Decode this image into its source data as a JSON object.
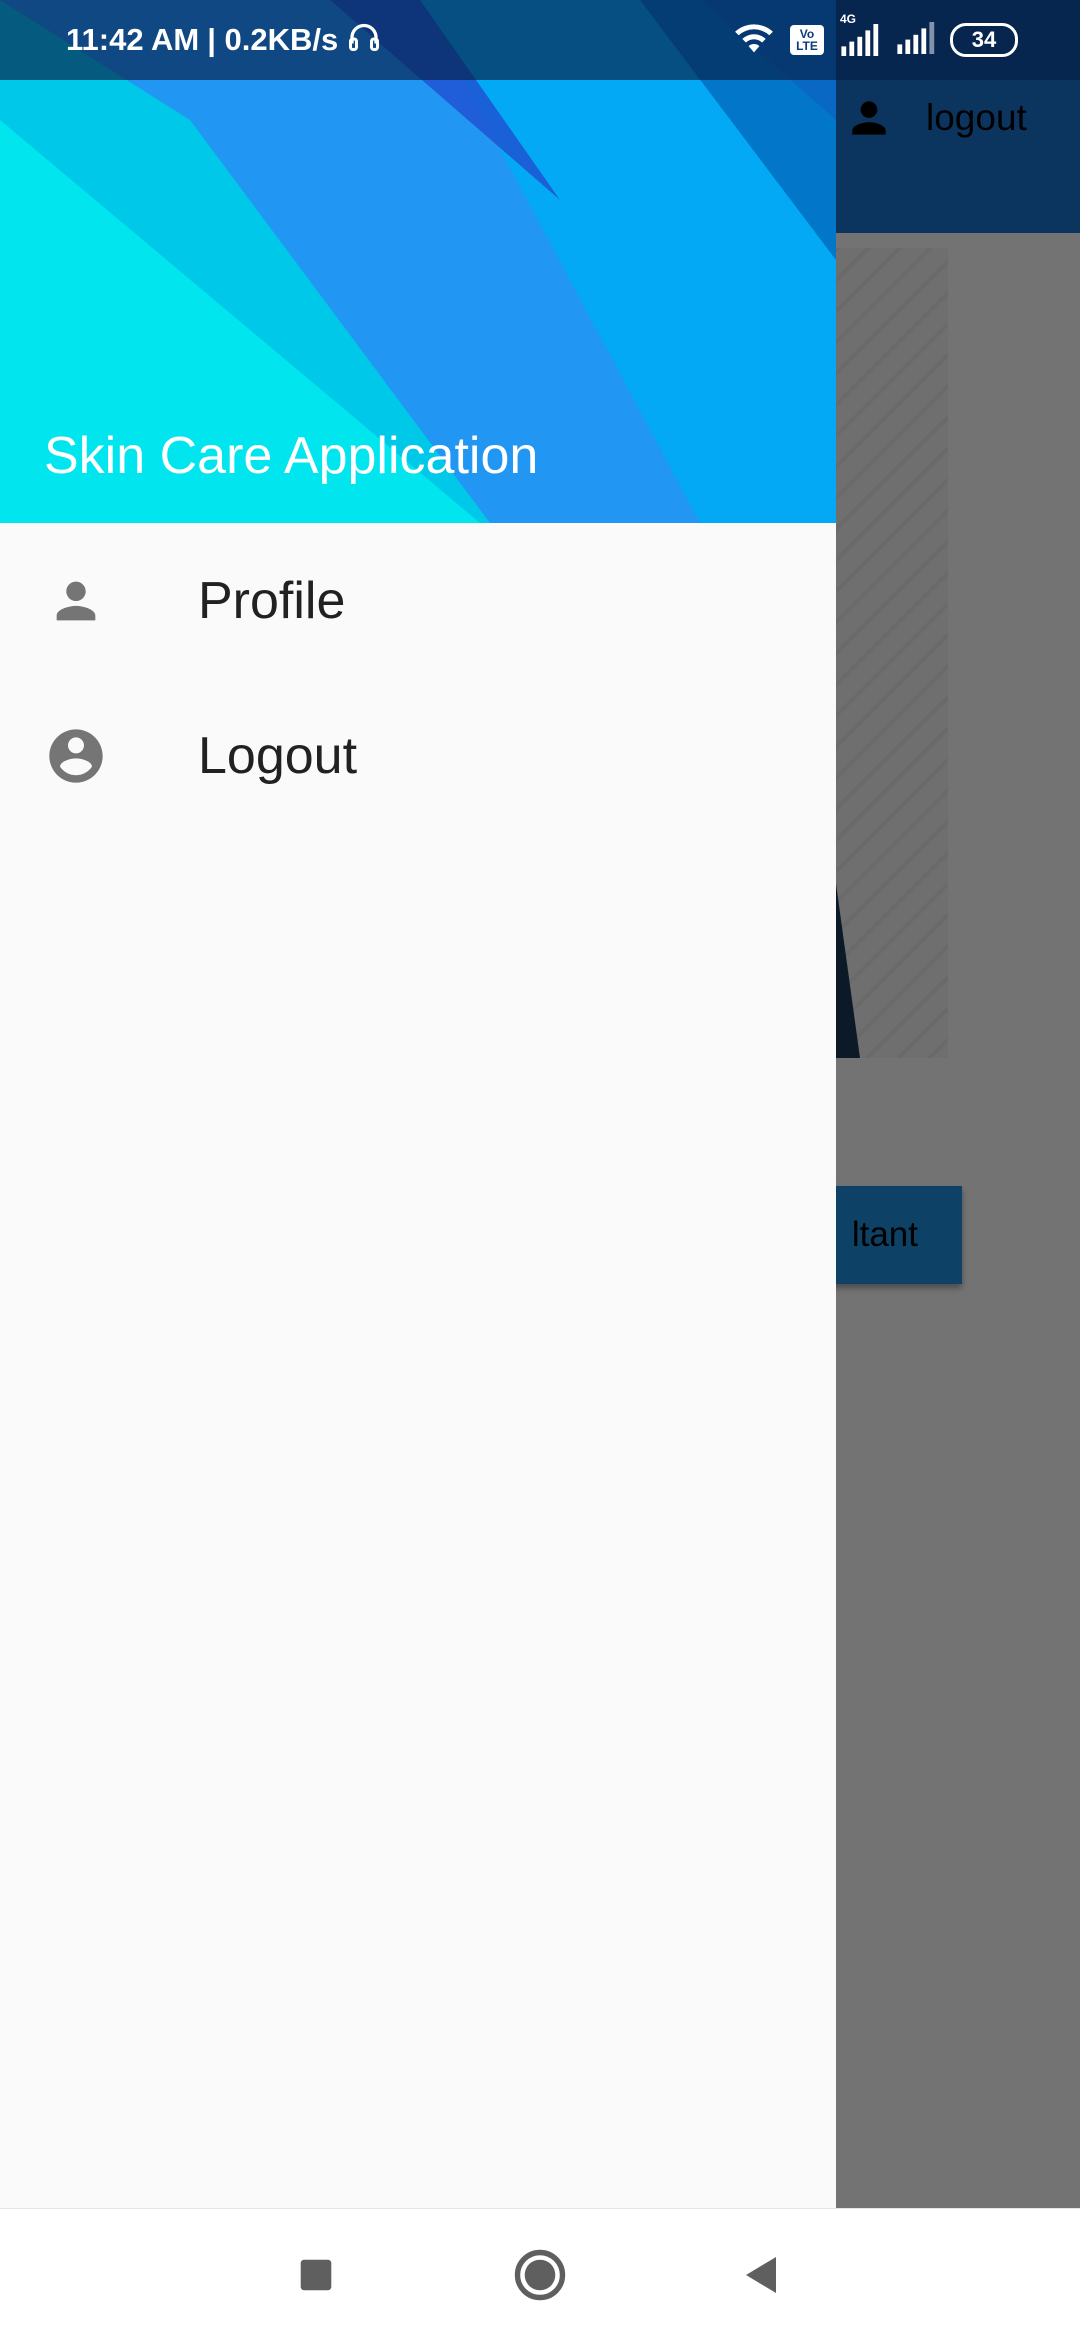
{
  "status_bar": {
    "time": "11:42 AM",
    "network_speed": "| 0.2KB/s",
    "battery_level": "34",
    "volte_top": "Vo",
    "volte_bottom": "LTE",
    "network_type": "4G",
    "icons": [
      "headphones-icon",
      "wifi-icon",
      "volte-icon",
      "signal-icon",
      "signal-icon",
      "battery-icon"
    ]
  },
  "background_app": {
    "appbar_action_label": "logout",
    "appbar_action_icon": "person-icon",
    "button_label_visible": "ltant",
    "appbar_color": "#1976d2",
    "button_color": "#1e90e0"
  },
  "drawer": {
    "header_title": "Skin Care Application",
    "header_colors": [
      "#00e5ee",
      "#03a9f4",
      "#1976d2",
      "#1e4fd0"
    ],
    "items": [
      {
        "label": "Profile",
        "icon": "person-icon"
      },
      {
        "label": "Logout",
        "icon": "account-circle-icon"
      }
    ]
  },
  "nav_bar": {
    "buttons": [
      "recents-square-icon",
      "home-circle-icon",
      "back-triangle-icon"
    ]
  }
}
